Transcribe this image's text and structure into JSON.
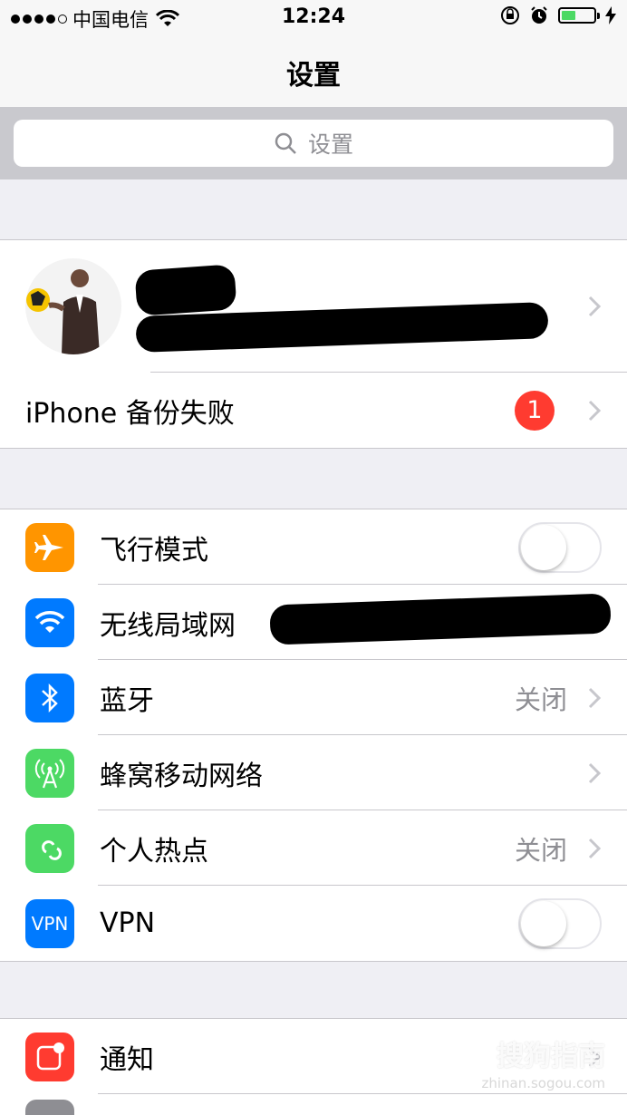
{
  "status_bar": {
    "carrier": "中国电信",
    "time": "12:24"
  },
  "nav": {
    "title": "设置"
  },
  "search": {
    "placeholder": "设置"
  },
  "profile": {
    "backup_label": "iPhone 备份失败",
    "backup_badge": "1"
  },
  "connectivity": {
    "items": [
      {
        "label": "飞行模式",
        "icon": "airplane-icon",
        "color": "#ff9500"
      },
      {
        "label": "无线局域网",
        "icon": "wifi-icon",
        "color": "#007aff"
      },
      {
        "label": "蓝牙",
        "value": "关闭",
        "icon": "bluetooth-icon",
        "color": "#007aff"
      },
      {
        "label": "蜂窝移动网络",
        "icon": "cellular-icon",
        "color": "#4cd964"
      },
      {
        "label": "个人热点",
        "value": "关闭",
        "icon": "hotspot-icon",
        "color": "#4cd964"
      },
      {
        "label": "VPN",
        "icon": "vpn-icon",
        "icon_text": "VPN",
        "color": "#007aff"
      }
    ]
  },
  "notifications": {
    "items": [
      {
        "label": "通知",
        "icon": "notifications-icon",
        "color": "#ff3b30"
      }
    ]
  },
  "watermark": {
    "text": "搜狗指南",
    "url": "zhinan.sogou.com"
  }
}
